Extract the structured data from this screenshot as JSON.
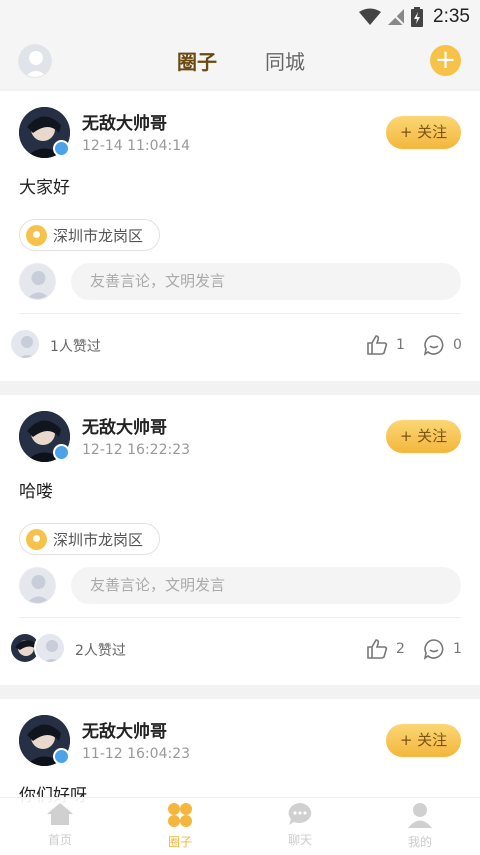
{
  "status_bar": {
    "time": "2:35"
  },
  "top_bar": {
    "tabs": [
      {
        "label": "圈子",
        "active": true
      },
      {
        "label": "同城",
        "active": false
      }
    ],
    "add_label": "+"
  },
  "posts": [
    {
      "username": "无敌大帅哥",
      "time": "12-14 11:04:14",
      "follow_label": "+ 关注",
      "text": "大家好",
      "location": "深圳市龙岗区",
      "comment_placeholder": "友善言论，文明发言",
      "likes_summary": "1人赞过",
      "like_count": "1",
      "comment_count": "0"
    },
    {
      "username": "无敌大帅哥",
      "time": "12-12 16:22:23",
      "follow_label": "+ 关注",
      "text": "哈喽",
      "location": "深圳市龙岗区",
      "comment_placeholder": "友善言论，文明发言",
      "likes_summary": "2人赞过",
      "like_count": "2",
      "comment_count": "1"
    },
    {
      "username": "无敌大帅哥",
      "time": "11-12 16:04:23",
      "follow_label": "+ 关注",
      "text": "你们好呀"
    }
  ],
  "bottom_nav": [
    {
      "label": "首页",
      "icon": "home-icon",
      "active": false
    },
    {
      "label": "圈子",
      "icon": "circle-grid-icon",
      "active": true
    },
    {
      "label": "聊天",
      "icon": "chat-icon",
      "active": false
    },
    {
      "label": "我的",
      "icon": "profile-icon",
      "active": false
    }
  ],
  "colors": {
    "accent": "#f4b63d",
    "gender_badge": "#4aa3e8"
  }
}
